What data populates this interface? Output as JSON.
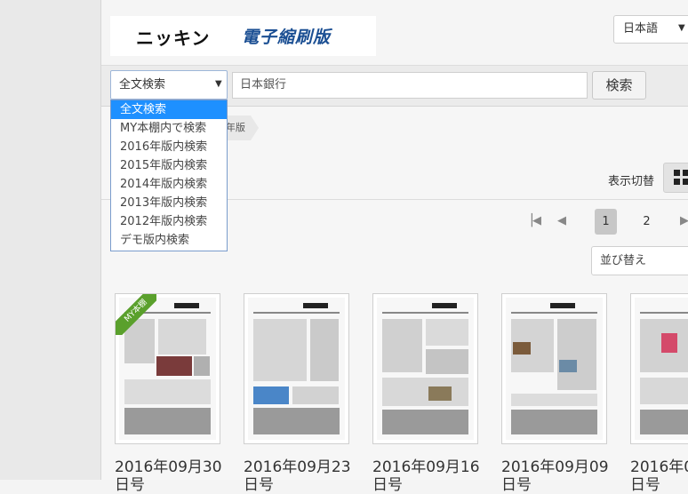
{
  "header": {
    "logo_main": "ニッキン",
    "logo_sub": "電子縮刷版",
    "language": {
      "selected": "日本語"
    }
  },
  "search": {
    "scope_selected": "全文検索",
    "query_value": "日本銀行",
    "button_label": "検索",
    "scope_options": [
      "全文検索",
      "MY本棚内で検索",
      "2016年版内検索",
      "2015年版内検索",
      "2014年版内検索",
      "2013年版内検索",
      "2012年版内検索",
      "デモ版内検索"
    ],
    "scope_highlighted_index": 0
  },
  "breadcrumb": {
    "tail_text": "年版"
  },
  "view_toggle": {
    "label": "表示切替",
    "icon": "grid-icon"
  },
  "pagination": {
    "pages": [
      "1",
      "2"
    ],
    "current": "1"
  },
  "sort": {
    "label": "並び替え"
  },
  "ribbon": {
    "label": "MY本棚",
    "color": "#5aa02c"
  },
  "issues": [
    {
      "date_line1": "2016年09月30",
      "date_line2": "日号"
    },
    {
      "date_line1": "2016年09月23",
      "date_line2": "日号"
    },
    {
      "date_line1": "2016年09月16",
      "date_line2": "日号"
    },
    {
      "date_line1": "2016年09月09",
      "date_line2": "日号"
    },
    {
      "date_line1": "2016年0",
      "date_line2": "日号"
    }
  ]
}
